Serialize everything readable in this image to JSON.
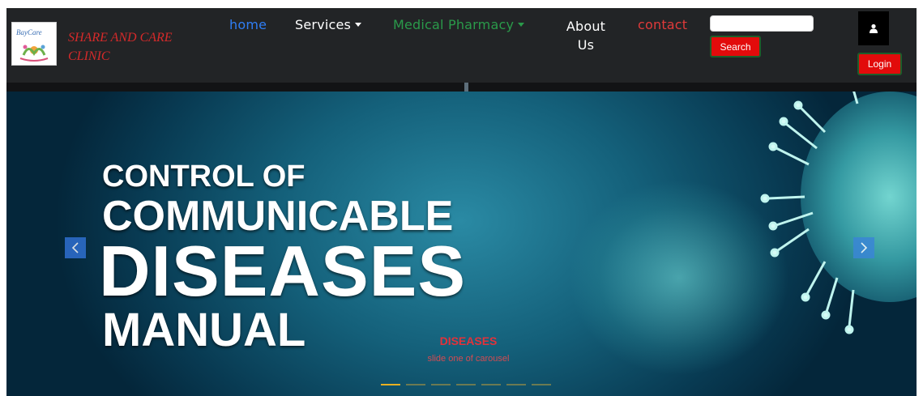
{
  "brand": {
    "name_line1": "SHARE AND CARE",
    "name_line2": "CLINIC",
    "logo_icon": "clinic-logo-icon"
  },
  "nav": {
    "home": "home",
    "services": "Services",
    "pharmacy": "Medical Pharmacy",
    "about": "About Us",
    "contact": "contact"
  },
  "search": {
    "placeholder": "",
    "value": "",
    "button_label": "Search"
  },
  "account": {
    "user_icon": "user-icon",
    "login_label": "Login"
  },
  "carousel": {
    "slide_heading_lines": [
      "CONTROL OF",
      "COMMUNICABLE",
      "DISEASES",
      "MANUAL"
    ],
    "caption_title": "DISEASES",
    "caption_text": "slide one of carousel",
    "prev_icon": "chevron-left-icon",
    "next_icon": "chevron-right-icon",
    "indicator_count": 7,
    "active_index": 0
  },
  "colors": {
    "nav_bg": "#222426",
    "home_link": "#2f7ef5",
    "pharmacy_link": "#2a9a4a",
    "contact_link": "#e03a3a",
    "button_red": "#e20b0b",
    "brand_red": "#d62a2a",
    "indicator_active": "#e8b021"
  }
}
